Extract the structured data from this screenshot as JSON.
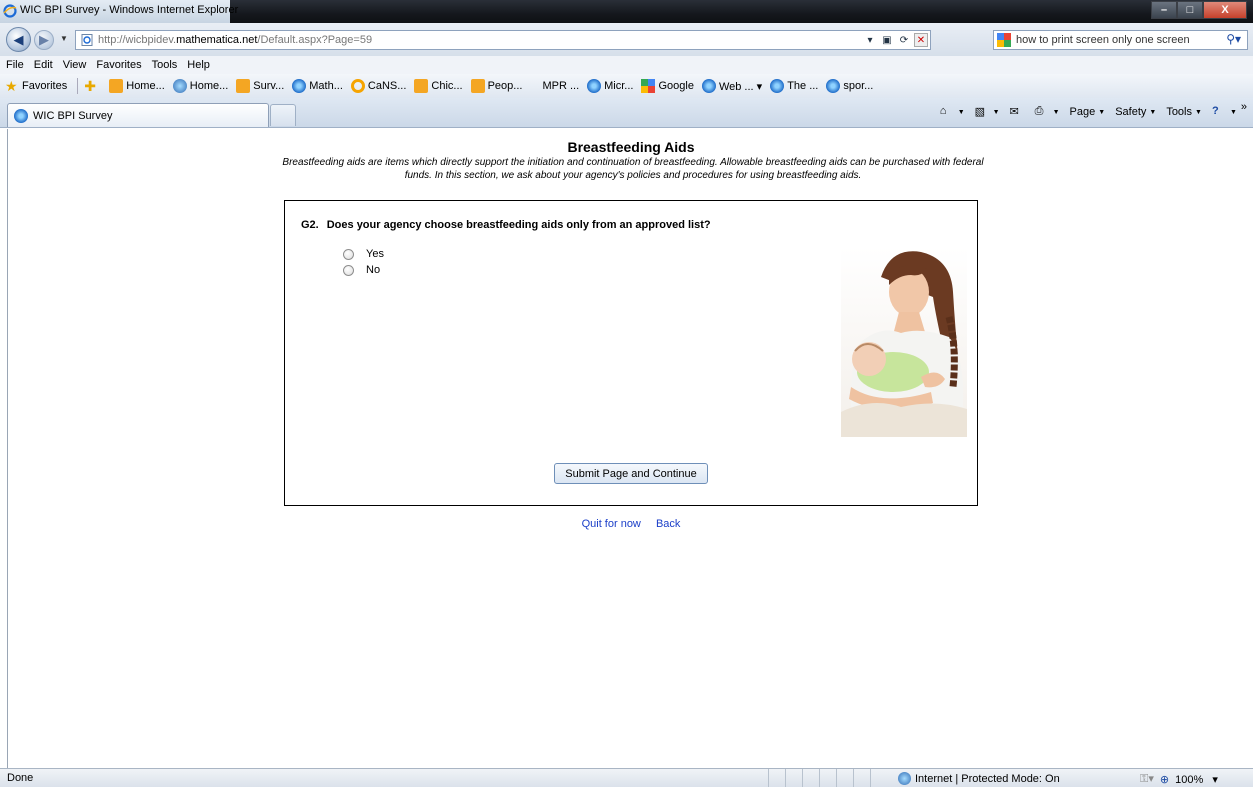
{
  "window": {
    "title": "WIC BPI Survey - Windows Internet Explorer",
    "minimize_label": "–",
    "maximize_label": "□",
    "close_label": "X"
  },
  "address": {
    "url_prefix": "http://wicbpidev.",
    "url_domain": "mathematica.net",
    "url_suffix": "/Default.aspx?Page=59",
    "search_text": "how to print screen only one screen"
  },
  "menu": [
    "File",
    "Edit",
    "View",
    "Favorites",
    "Tools",
    "Help"
  ],
  "favorites": {
    "label": "Favorites",
    "items": [
      {
        "label": "Home...",
        "icon": "rss"
      },
      {
        "label": "Home...",
        "icon": "globe"
      },
      {
        "label": "Surv...",
        "icon": "rss"
      },
      {
        "label": "Math...",
        "icon": "ie"
      },
      {
        "label": "CaNS...",
        "icon": "ring"
      },
      {
        "label": "Chic...",
        "icon": "rss"
      },
      {
        "label": "Peop...",
        "icon": "rss"
      },
      {
        "label": "MPR ...",
        "icon": "none"
      },
      {
        "label": "Micr...",
        "icon": "ie"
      },
      {
        "label": "Google",
        "icon": "google"
      },
      {
        "label": "Web ... ▾",
        "icon": "ie"
      },
      {
        "label": "The ...",
        "icon": "ie"
      },
      {
        "label": "spor...",
        "icon": "ie"
      }
    ]
  },
  "tabs": [
    {
      "label": "WIC BPI Survey",
      "active": true
    }
  ],
  "command_bar": {
    "page": "Page",
    "safety": "Safety",
    "tools": "Tools",
    "overflow": "»"
  },
  "page": {
    "title": "Breastfeeding Aids",
    "intro": "Breastfeeding aids are items which directly support the initiation and continuation of breastfeeding. Allowable breastfeeding aids can be purchased with federal funds. In this section, we ask about your agency's policies and procedures for using breastfeeding aids.",
    "question_number": "G2.",
    "question_text": "Does your agency choose breastfeeding aids only from an approved list?",
    "options": [
      "Yes",
      "No"
    ],
    "submit_label": "Submit Page and Continue",
    "quit_label": "Quit for now",
    "back_label": "Back"
  },
  "status": {
    "left": "Done",
    "zone": "Internet | Protected Mode: On",
    "zoom": "100%"
  },
  "colors": {
    "link": "#1a3ec8",
    "title_bar": "#15181d"
  }
}
